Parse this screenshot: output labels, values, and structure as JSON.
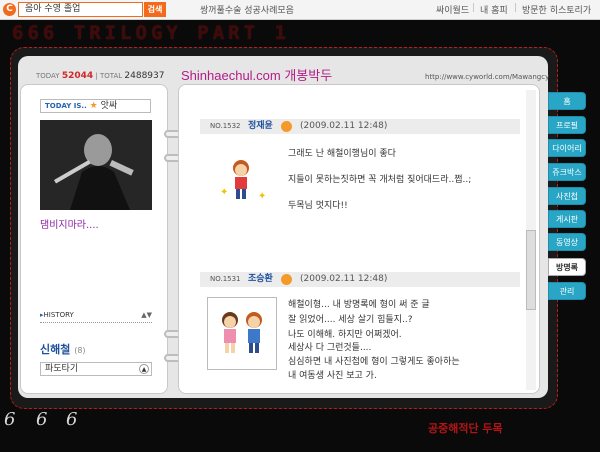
{
  "topbar": {
    "logo_glyph": "C",
    "search_value": "음아 수영 졸업",
    "search_button": "검색",
    "promo_link": "쌍꺼풀수술 성공사례모음",
    "links": [
      "싸이월드",
      "내 홈피",
      "방문한 히스토리가"
    ]
  },
  "banner": "666 TRILOGY PART 1",
  "counter": {
    "today_label": "TODAY",
    "today_value": "52044",
    "sep": "|",
    "total_label": "TOTAL",
    "total_value": "2488937"
  },
  "title": "Shinhaechul.com 개봉박두",
  "url": "http://www.cyworld.com/Mawangcy",
  "sidebar": {
    "today_tag": "TODAY IS..",
    "mood": "앗싸",
    "photo_caption": "댐비지마라....",
    "history_label": "HISTORY",
    "history_arrows": "▲▼",
    "owner_name": "신해철",
    "owner_count": "(8)",
    "wave_label": "파도타기",
    "wave_btn": "▲"
  },
  "entries": [
    {
      "no": "NO.1532",
      "name": "정재윤",
      "date": "(2009.02.11 12:48)",
      "lines": [
        "그래도 난 해철이행님이 좋다",
        "지들이 못하는짓하면 꼭 개처럼 짖어대드라..쩝..;",
        "두목님 멋지다!!"
      ]
    },
    {
      "no": "NO.1531",
      "name": "조승환",
      "date": "(2009.02.11 12:48)",
      "lines": [
        "해철이형... 내 방명록에 형이 써 준 글",
        "잘 읽었어.... 세상 살기 힘들지..?",
        "나도 이해해. 하지만 어쩌겠어.",
        "세상사 다 그런것들....",
        "심심하면 내 사진첩에 형이 그렇게도 좋아하는",
        "내 여동생 사진 보고 가."
      ]
    }
  ],
  "tabs": [
    "홈",
    "프로필",
    "다이어리",
    "쥬크박스",
    "사진첩",
    "게시판",
    "동영상",
    "방명록",
    "관리"
  ],
  "active_tab": "방명록",
  "footer": "공중해적단 두목",
  "sixes": [
    "6",
    "6",
    "6"
  ]
}
